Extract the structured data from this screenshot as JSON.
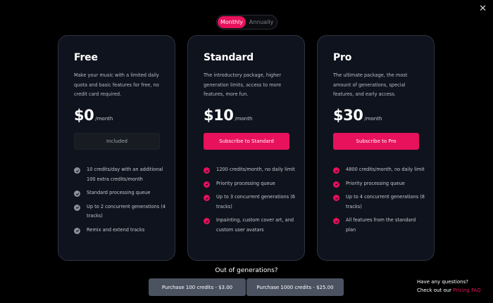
{
  "billing_toggle": {
    "monthly": "Monthly",
    "annually": "Annually"
  },
  "close_symbol": "✕",
  "plans": [
    {
      "name": "Free",
      "description": "Make your music with a limited daily quota and basic features for free, no credit card required.",
      "price": "$0",
      "period": "/month",
      "cta": "Included",
      "features": [
        "10 credits/day with an additional 100 extra credits/month",
        "Standard processing queue",
        "Up to 2 concurrent generations (4 tracks)",
        "Remix and extend tracks"
      ]
    },
    {
      "name": "Standard",
      "description": "The introductory package, higher generation limits, access to more features, more fun.",
      "price": "$10",
      "period": "/month",
      "cta": "Subscribe to Standard",
      "features": [
        "1200 credits/month, no daily limit",
        "Priority processing queue",
        "Up to 3 concurrent generations (6 tracks)",
        "Inpainting, custom cover art, and custom user avatars"
      ]
    },
    {
      "name": "Pro",
      "description": "The ultimate package, the most amount of generations, special features, and early access.",
      "price": "$30",
      "period": "/month",
      "cta": "Subscribe to Pro",
      "features": [
        "4800 credits/month, no daily limit",
        "Priority processing queue",
        "Up to 4 concurrent generations (8 tracks)",
        "All features from the standard plan"
      ]
    }
  ],
  "out_of_generations": "Out of generations?",
  "purchase": {
    "small": "Purchase 100 credits - $3.00",
    "large": "Purchase 1000 credits - $25.00"
  },
  "faq": {
    "question": "Have any questions?",
    "prefix": "Check out our ",
    "link": "Pricing FAQ"
  },
  "colors": {
    "accent": "#e8115c",
    "background": "#000000",
    "card": "#0f131d",
    "included_check": "#8a8f99"
  }
}
